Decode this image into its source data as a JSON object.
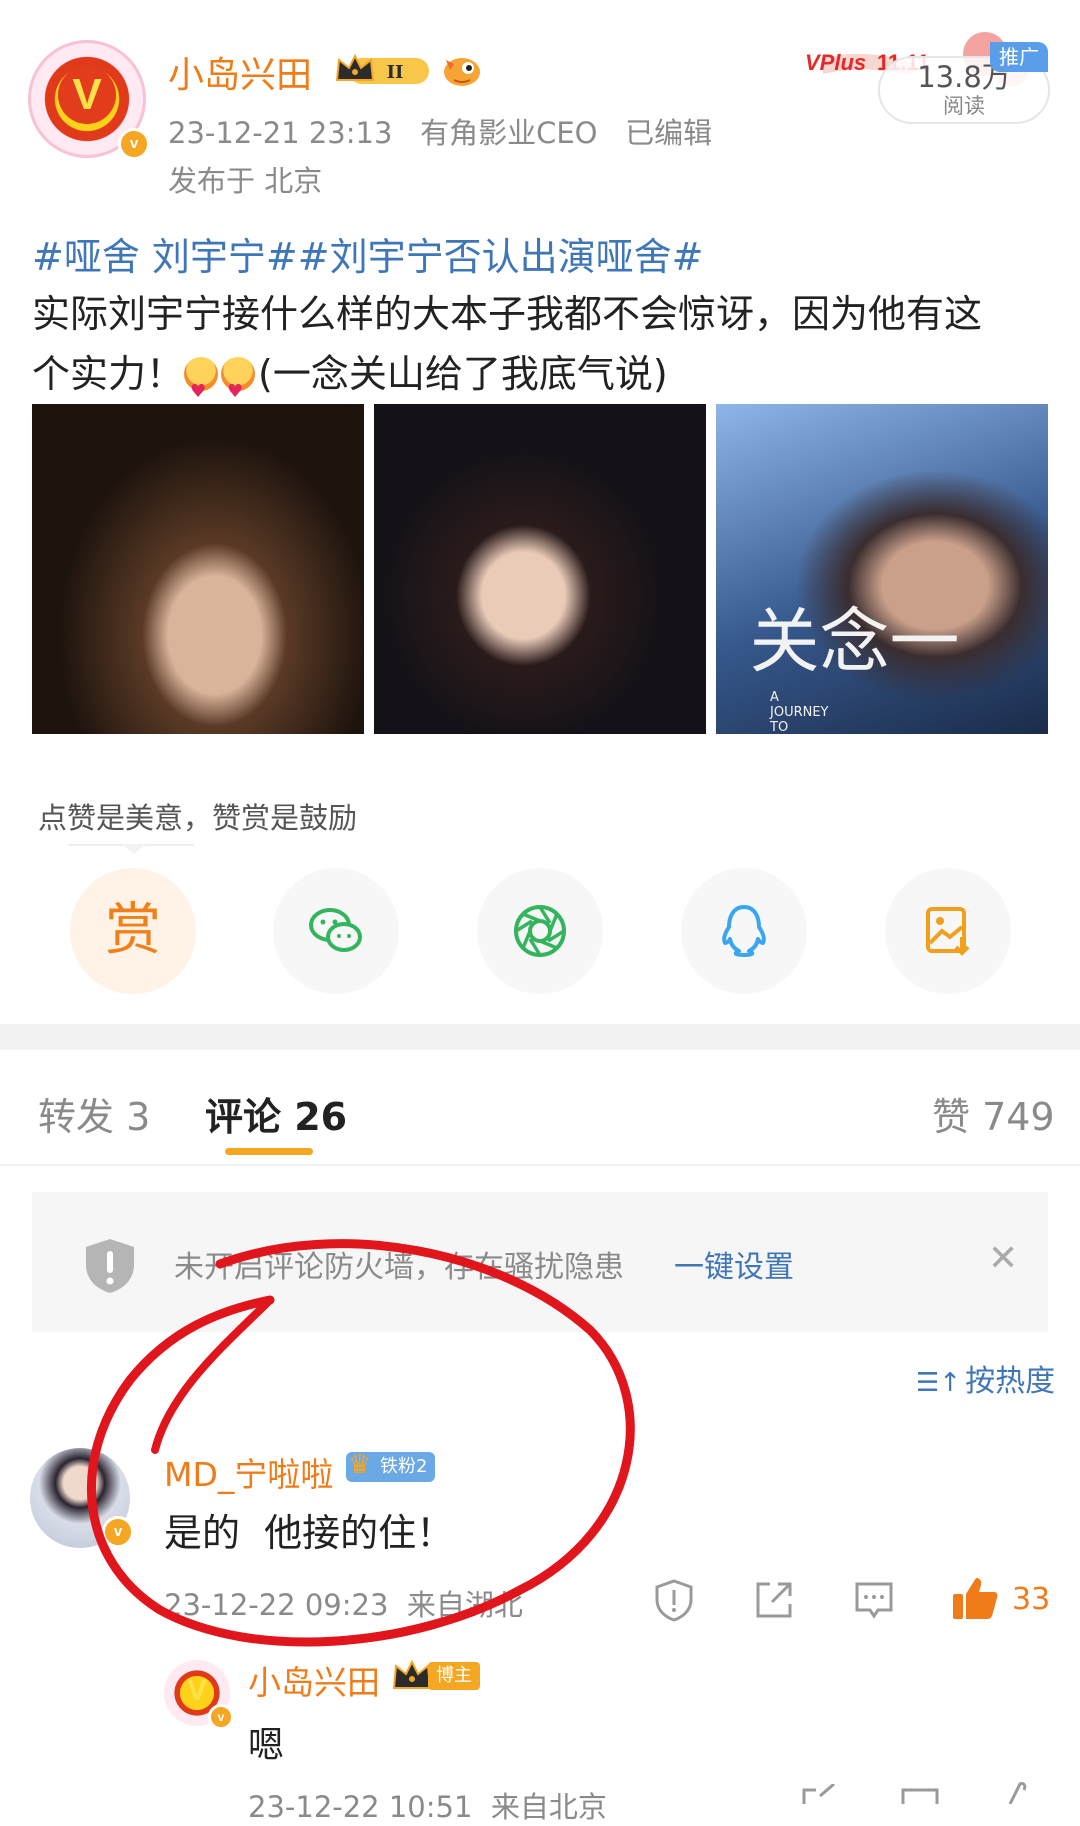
{
  "post": {
    "author": "小岛兴田",
    "author_level": "II",
    "timestamp": "23-12-21 23:13",
    "author_title": "有角影业CEO",
    "edited": "已编辑",
    "location": "发布于 北京",
    "tags": [
      "#哑舍 刘宇宁#",
      "#刘宇宁否认出演哑舍#"
    ],
    "content_line1": "实际刘宇宁接什么样的大本子我都不会惊讶，因为他有这",
    "content_line2_a": "个实力！",
    "content_line2_b": "(一念关山给了我底气说)",
    "photo3_title": "一念关",
    "photo3_en": "A\nJOURNEY\nTO\nLOVE"
  },
  "header": {
    "brand": "VPlus",
    "read_count": "13.8万",
    "read_label": "阅读",
    "promo_label": "推广"
  },
  "reward": {
    "tip": "点赞是美意，赞赏是鼓励",
    "reward_label": "赏"
  },
  "tabs": {
    "forward": "转发 3",
    "comments": "评论 26",
    "likes": "赞 749"
  },
  "notice": {
    "text": "未开启评论防火墙，存在骚扰隐患",
    "action": "一键设置"
  },
  "sort": {
    "label": "按热度"
  },
  "comment": {
    "name": "MD_宁啦啦",
    "badge": "铁粉2",
    "text": "是的  他接的住！",
    "time": "23-12-22 09:23  来自湖北",
    "likes": "33"
  },
  "reply": {
    "name": "小岛兴田",
    "badge": "博主",
    "text": "嗯",
    "time": "23-12-22 10:51  来自北京"
  },
  "colors": {
    "accent_orange": "#f07b19",
    "link_blue": "#3f76b8",
    "annotation_red": "#e0161c"
  }
}
